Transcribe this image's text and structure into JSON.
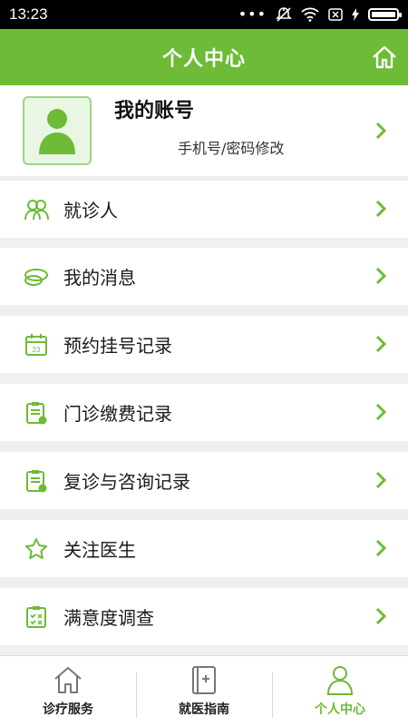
{
  "status_bar": {
    "time": "13:23"
  },
  "header": {
    "title": "个人中心",
    "home_icon": "home-icon"
  },
  "account": {
    "name": "我的账号",
    "subtitle": "手机号/密码修改"
  },
  "menu": [
    {
      "label": "就诊人",
      "icon": "patients-icon"
    },
    {
      "label": "我的消息",
      "icon": "message-icon"
    },
    {
      "label": "预约挂号记录",
      "icon": "calendar-icon"
    },
    {
      "label": "门诊缴费记录",
      "icon": "payment-record-icon"
    },
    {
      "label": "复诊与咨询记录",
      "icon": "consult-record-icon"
    },
    {
      "label": "关注医生",
      "icon": "star-icon"
    },
    {
      "label": "满意度调查",
      "icon": "survey-icon"
    }
  ],
  "tabs": [
    {
      "label": "诊疗服务",
      "icon": "home-outline-icon",
      "active": false
    },
    {
      "label": "就医指南",
      "icon": "guide-book-icon",
      "active": false
    },
    {
      "label": "个人中心",
      "icon": "person-icon",
      "active": true
    }
  ],
  "colors": {
    "brand": "#6dbb36",
    "accent_light": "#9fd48a",
    "background": "#efefef"
  }
}
